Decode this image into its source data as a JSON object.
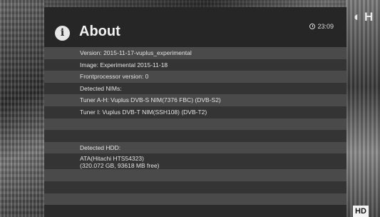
{
  "channel": {
    "logo": "H",
    "hd_badge": "HD"
  },
  "window": {
    "title": "About",
    "icon": "info-icon",
    "clock": "23:09"
  },
  "info": {
    "version": "Version: 2015-11-17-vuplus_experimental",
    "image": "Image: Experimental 2015-11-18",
    "frontprocessor": "Frontprocessor version: 0",
    "detected_nims": "Detected NIMs:",
    "tuner_ah": "Tuner A-H: Vuplus DVB-S NIM(7376 FBC) (DVB-S2)",
    "tuner_i": "Tuner I: Vuplus DVB-T NIM(SSH108) (DVB-T2)",
    "detected_hdd": "Detected HDD:",
    "hdd_model": "ATA(Hitachi HTS54323)",
    "hdd_capacity": "(320.072 GB, 93618 MB free)"
  }
}
